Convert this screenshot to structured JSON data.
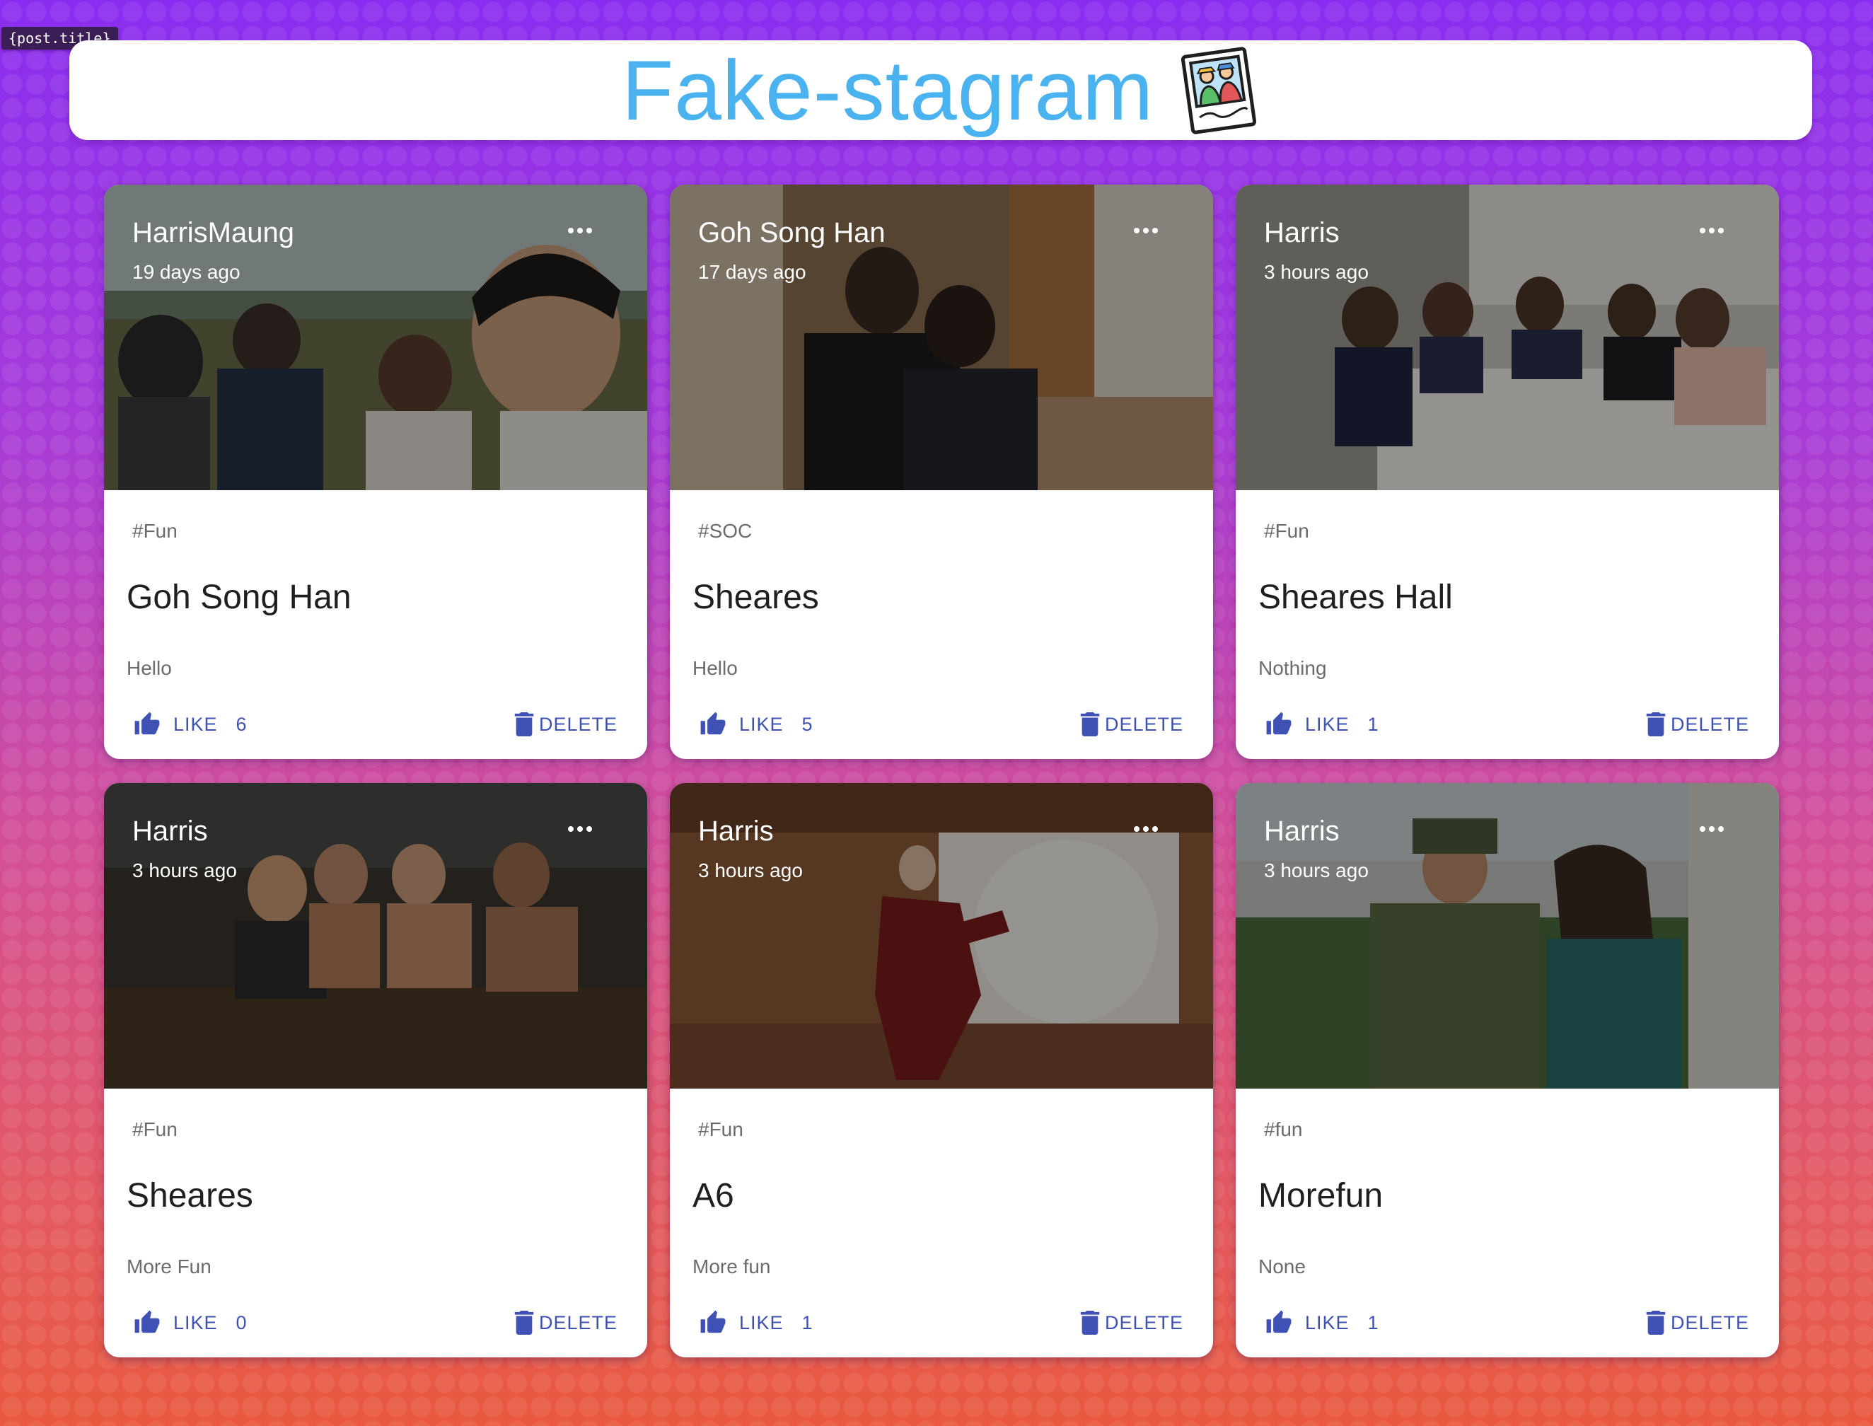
{
  "debug_label": "{post.title}",
  "app": {
    "title": "Fake-stagram",
    "logo_icon": "photo-polaroid-icon",
    "title_color": "#4ab3ef"
  },
  "colors": {
    "accent": "#3f51b5",
    "gradient_top": "#8a2df0",
    "gradient_bottom": "#e9593f"
  },
  "posts": [
    {
      "creator": "HarrisMaung",
      "time": "19 days ago",
      "tags": "#Fun",
      "title": "Goh Song Han",
      "message": "Hello",
      "like_label": "LIKE",
      "like_count": "6",
      "delete_label": "DELETE"
    },
    {
      "creator": "Goh Song Han",
      "time": "17 days ago",
      "tags": "#SOC",
      "title": "Sheares",
      "message": "Hello",
      "like_label": "LIKE",
      "like_count": "5",
      "delete_label": "DELETE"
    },
    {
      "creator": "Harris",
      "time": "3 hours ago",
      "tags": "#Fun",
      "title": "Sheares Hall",
      "message": "Nothing",
      "like_label": "LIKE",
      "like_count": "1",
      "delete_label": "DELETE"
    },
    {
      "creator": "Harris",
      "time": "3 hours ago",
      "tags": "#Fun",
      "title": "Sheares",
      "message": "More Fun",
      "like_label": "LIKE",
      "like_count": "0",
      "delete_label": "DELETE"
    },
    {
      "creator": "Harris",
      "time": "3 hours ago",
      "tags": "#Fun",
      "title": "A6",
      "message": "More fun",
      "like_label": "LIKE",
      "like_count": "1",
      "delete_label": "DELETE"
    },
    {
      "creator": "Harris",
      "time": "3 hours ago",
      "tags": "#fun",
      "title": "Morefun",
      "message": "None",
      "like_label": "LIKE",
      "like_count": "1",
      "delete_label": "DELETE"
    }
  ]
}
